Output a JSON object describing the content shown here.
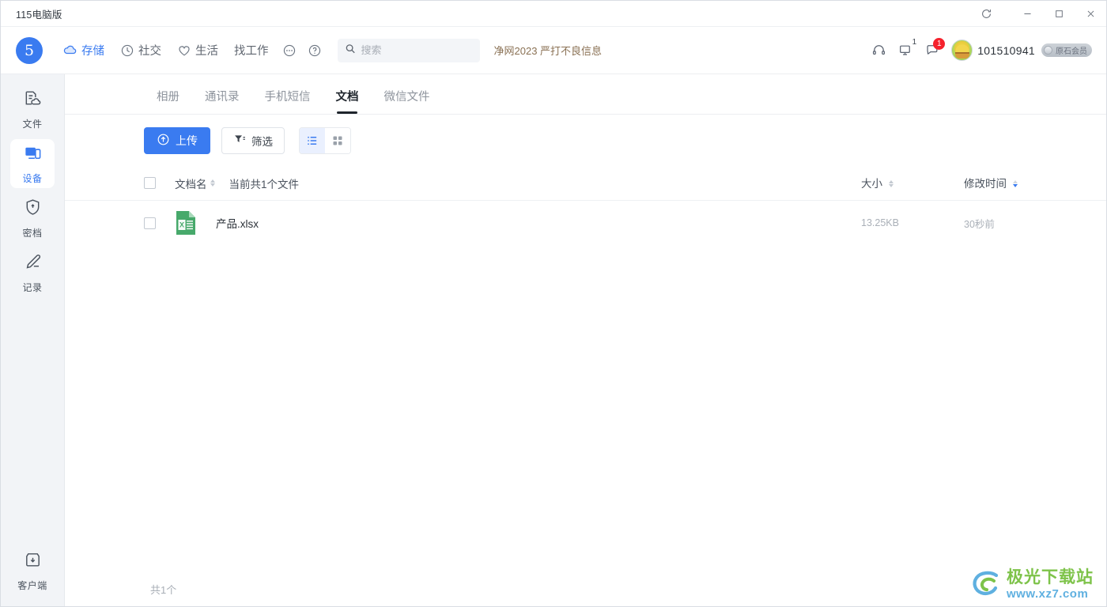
{
  "window": {
    "title": "115电脑版",
    "controls": {
      "refresh": "refresh-icon",
      "minimize": "minimize-icon",
      "maximize": "maximize-icon",
      "close": "close-icon"
    }
  },
  "header": {
    "logo_text": "5",
    "nav": [
      {
        "label": "存储",
        "icon": "cloud-icon",
        "active": true
      },
      {
        "label": "社交",
        "icon": "clock-icon",
        "active": false
      },
      {
        "label": "生活",
        "icon": "heart-icon",
        "active": false
      },
      {
        "label": "找工作",
        "icon": "",
        "active": false
      },
      {
        "label": "",
        "icon": "more-icon",
        "active": false
      },
      {
        "label": "",
        "icon": "help-icon",
        "active": false
      }
    ],
    "search": {
      "placeholder": "搜索",
      "value": ""
    },
    "notice": "净网2023 严打不良信息",
    "right": {
      "headset_icon": "headset-icon",
      "monitor_icon": "monitor-icon",
      "monitor_badge": "1",
      "message_icon": "message-icon",
      "message_badge": "1",
      "username": "101510941",
      "vip_label": "原石会员"
    }
  },
  "sidebar": {
    "items": [
      {
        "label": "文件",
        "icon": "file-cloud-icon",
        "active": false
      },
      {
        "label": "设备",
        "icon": "device-icon",
        "active": true
      },
      {
        "label": "密档",
        "icon": "shield-lock-icon",
        "active": false
      },
      {
        "label": "记录",
        "icon": "pencil-icon",
        "active": false
      }
    ],
    "bottom": {
      "label": "客户端",
      "icon": "download-box-icon"
    }
  },
  "main": {
    "tabs": [
      {
        "label": "相册",
        "active": false
      },
      {
        "label": "通讯录",
        "active": false
      },
      {
        "label": "手机短信",
        "active": false
      },
      {
        "label": "文档",
        "active": true
      },
      {
        "label": "微信文件",
        "active": false
      }
    ],
    "toolbar": {
      "upload_label": "上传",
      "filter_label": "筛选",
      "list_view_icon": "list-view-icon",
      "grid_view_icon": "grid-view-icon",
      "active_view": "list"
    },
    "table": {
      "headers": {
        "name": "文档名",
        "count_text": "当前共1个文件",
        "size": "大小",
        "modified": "修改时间"
      },
      "rows": [
        {
          "name": "产品.xlsx",
          "icon": "excel-file-icon",
          "size": "13.25KB",
          "modified": "30秒前",
          "checked": false
        }
      ]
    },
    "footer": {
      "total_text": "共1个"
    }
  },
  "watermark": {
    "line1": "极光下载站",
    "line2": "www.xz7.com"
  },
  "colors": {
    "accent": "#3a7bf0",
    "sidebar_bg": "#f2f4f7",
    "badge_red": "#f5222d",
    "excel_green": "#3fa569",
    "notice_brown": "#8a7154"
  }
}
